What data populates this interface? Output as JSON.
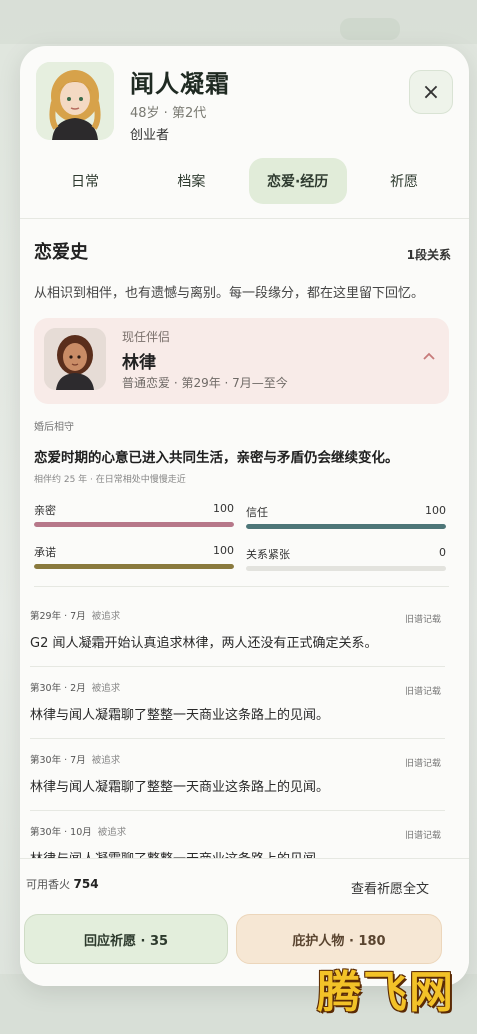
{
  "profile": {
    "name": "闻人凝霜",
    "meta": "48岁 · 第2代",
    "role": "创业者",
    "close_icon": "×"
  },
  "tabs": [
    {
      "label": "日常",
      "active": false
    },
    {
      "label": "档案",
      "active": false
    },
    {
      "label": "恋爱·经历",
      "active": true
    },
    {
      "label": "祈愿",
      "active": false
    }
  ],
  "love": {
    "title": "恋爱史",
    "count": "1段关系",
    "description": "从相识到相伴，也有遗憾与离别。每一段缘分，都在这里留下回忆。"
  },
  "partner": {
    "label": "现任伴侣",
    "name": "林律",
    "subtitle": "普通恋爱 · 第29年 · 7月—至今",
    "chevron_icon": "chevron-up-icon"
  },
  "stage": {
    "label": "婚后相守",
    "text": "恋爱时期的心意已进入共同生活，亲密与矛盾仍会继续变化。",
    "sub": "相伴约 25 年 · 在日常相处中慢慢走近"
  },
  "stats": [
    {
      "label": "亲密",
      "value": "100",
      "level": 100,
      "color": "#b7788a"
    },
    {
      "label": "信任",
      "value": "100",
      "level": 100,
      "color": "#4d7678"
    },
    {
      "label": "承诺",
      "value": "100",
      "level": 100,
      "color": "#8a7a3e"
    },
    {
      "label": "关系紧张",
      "value": "0",
      "level": 0,
      "color": "#b0b0b0"
    }
  ],
  "entries": [
    {
      "date": "第29年 · 7月",
      "tag": "被追求",
      "source": "旧谱记载",
      "text": "G2 闻人凝霜开始认真追求林律，两人还没有正式确定关系。"
    },
    {
      "date": "第30年 · 2月",
      "tag": "被追求",
      "source": "旧谱记载",
      "text": "林律与闻人凝霜聊了整整一天商业这条路上的见闻。"
    },
    {
      "date": "第30年 · 7月",
      "tag": "被追求",
      "source": "旧谱记载",
      "text": "林律与闻人凝霜聊了整整一天商业这条路上的见闻。"
    },
    {
      "date": "第30年 · 10月",
      "tag": "被追求",
      "source": "旧谱记载",
      "text": "林律与闻人凝霜聊了整整一天商业这条路上的见闻。"
    }
  ],
  "footer": {
    "fire_label": "可用香火",
    "fire_value": "754",
    "wish_link": "查看祈愿全文",
    "respond_button": "回应祈愿 · 35",
    "protect_button": "庇护人物 · 180"
  },
  "watermark": "腾飞网"
}
